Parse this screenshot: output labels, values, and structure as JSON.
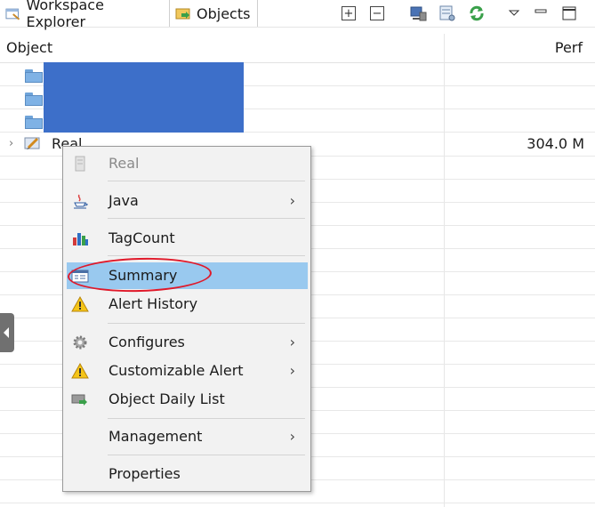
{
  "tabs": [
    {
      "label": "Workspace Explorer",
      "icon": "workspace-explorer-icon",
      "active": false
    },
    {
      "label": "Objects",
      "icon": "objects-folder-icon",
      "active": true
    }
  ],
  "toolbar": {
    "expand_symbol": "+",
    "collapse_symbol": "−",
    "icons": [
      "expand-all-icon",
      "collapse-all-icon",
      "monitor-icon",
      "filter-icon",
      "refresh-icon",
      "view-menu-icon",
      "minimize-icon",
      "maximize-icon"
    ]
  },
  "table": {
    "columns": [
      "Object",
      "Perf"
    ],
    "rows": [
      {
        "label": "",
        "perf": "",
        "icon": "folder-icon"
      },
      {
        "label": "",
        "perf": "",
        "icon": "folder-icon"
      },
      {
        "label": "",
        "perf": "",
        "icon": "folder-icon"
      },
      {
        "label": "Real",
        "perf": "304.0 M",
        "icon": "object-icon",
        "expander": "›"
      }
    ]
  },
  "context_menu": {
    "items": [
      {
        "label": "Real",
        "icon": "document-icon",
        "disabled": true,
        "submenu": false
      },
      {
        "label": "Java",
        "icon": "java-icon",
        "submenu": true
      },
      {
        "label": "TagCount",
        "icon": "bar-chart-icon",
        "submenu": false
      },
      {
        "label": "Summary",
        "icon": "summary-icon",
        "submenu": false,
        "selected": true
      },
      {
        "label": "Alert History",
        "icon": "warning-icon",
        "submenu": false
      },
      {
        "label": "Configures",
        "icon": "gear-icon",
        "submenu": true
      },
      {
        "label": "Customizable Alert",
        "icon": "warning-icon",
        "submenu": true
      },
      {
        "label": "Object Daily List",
        "icon": "daily-list-icon",
        "submenu": false
      },
      {
        "label": "Management",
        "icon": "",
        "submenu": true
      },
      {
        "label": "Properties",
        "icon": "",
        "submenu": false
      }
    ],
    "submenu_arrow": "›"
  },
  "colors": {
    "selection": "#99c9ef",
    "annotation": "#e0192a",
    "redaction": "#3d6fc9",
    "menu_bg": "#f2f2f2"
  }
}
